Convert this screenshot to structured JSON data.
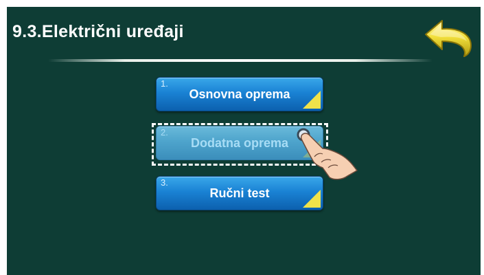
{
  "screen": {
    "title": "9.3.Električni uređaji",
    "back_icon": "back-arrow-icon",
    "background_color": "#0e3d35",
    "accent_color": "#1a82d4",
    "corner_color": "#f0e24a"
  },
  "menu": {
    "items": [
      {
        "number": "1.",
        "label": "Osnovna oprema",
        "selected": false
      },
      {
        "number": "2.",
        "label": "Dodatna oprema",
        "selected": true
      },
      {
        "number": "3.",
        "label": "Ručni test",
        "selected": false
      }
    ]
  },
  "pointer": {
    "icon": "hand-pointer-icon"
  }
}
